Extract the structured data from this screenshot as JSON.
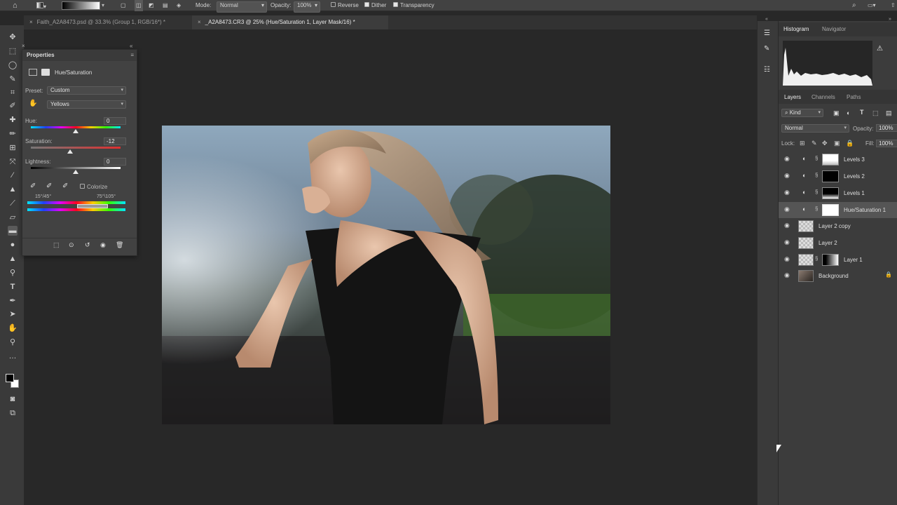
{
  "options_bar": {
    "mode_label": "Mode:",
    "mode_value": "Normal",
    "opacity_label": "Opacity:",
    "opacity_value": "100%",
    "reverse_label": "Reverse",
    "dither_label": "Dither",
    "transparency_label": "Transparency"
  },
  "tabs": [
    {
      "label": "Faith_A2A8473.psd @ 33.3% (Group 1, RGB/16*) *",
      "active": false
    },
    {
      "label": "_A2A8473.CR3 @ 25% (Hue/Saturation 1, Layer Mask/16) *",
      "active": true
    }
  ],
  "properties": {
    "title": "Properties",
    "adjustment_name": "Hue/Saturation",
    "preset_label": "Preset:",
    "preset_value": "Custom",
    "channel_value": "Yellows",
    "hue_label": "Hue:",
    "hue_value": "0",
    "hue_level": 0.5,
    "saturation_label": "Saturation:",
    "saturation_value": "-12",
    "saturation_level": 0.44,
    "lightness_label": "Lightness:",
    "lightness_value": "0",
    "lightness_level": 0.5,
    "colorize_label": "Colorize",
    "range_left": "15°/45°",
    "range_right": "75°\\105°"
  },
  "right_panel": {
    "top_tabs": [
      "Histogram",
      "Navigator"
    ],
    "layer_tabs": [
      "Layers",
      "Channels",
      "Paths"
    ],
    "kind_label": "Kind",
    "blend_mode": "Normal",
    "opacity_label": "Opacity:",
    "opacity_value": "100%",
    "lock_label": "Lock:",
    "fill_label": "Fill:",
    "fill_value": "100%",
    "layers": [
      {
        "name": "Levels 3",
        "type": "adjustment",
        "mask": "white-top"
      },
      {
        "name": "Levels 2",
        "type": "adjustment",
        "mask": "black"
      },
      {
        "name": "Levels 1",
        "type": "adjustment",
        "mask": "black-white"
      },
      {
        "name": "Hue/Saturation 1",
        "type": "adjustment",
        "mask": "white",
        "selected": true
      },
      {
        "name": "Layer 2 copy",
        "type": "pixel"
      },
      {
        "name": "Layer 2",
        "type": "pixel"
      },
      {
        "name": "Layer 1",
        "type": "pixel-mask"
      },
      {
        "name": "Background",
        "type": "background",
        "locked": true
      }
    ]
  },
  "colors": {
    "accent_selected_row": "#555555",
    "ui_dark": "#282828",
    "panel": "#424242"
  }
}
